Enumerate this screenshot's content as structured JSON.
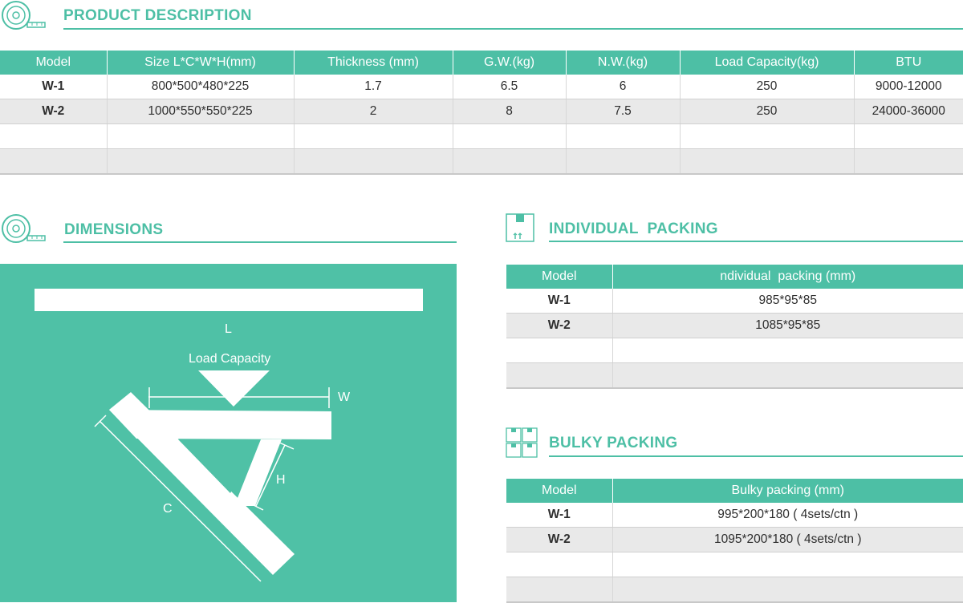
{
  "product_description": {
    "title": "PRODUCT DESCRIPTION",
    "icon": "tape-measure-icon",
    "columns": [
      "Model",
      "Size L*C*W*H(mm)",
      "Thickness (mm)",
      "G.W.(kg)",
      "N.W.(kg)",
      "Load Capacity(kg)",
      "BTU"
    ],
    "rows": [
      [
        "W-1",
        "800*500*480*225",
        "1.7",
        "6.5",
        "6",
        "250",
        "9000-12000"
      ],
      [
        "W-2",
        "1000*550*550*225",
        "2",
        "8",
        "7.5",
        "250",
        "24000-36000"
      ],
      [
        "",
        "",
        "",
        "",
        "",
        "",
        ""
      ],
      [
        "",
        "",
        "",
        "",
        "",
        "",
        ""
      ]
    ]
  },
  "dimensions": {
    "title": "DIMENSIONS",
    "icon": "tape-measure-icon",
    "labels": {
      "l": "L",
      "load_capacity": "Load Capacity",
      "w": "W",
      "h": "H",
      "c": "C"
    }
  },
  "individual_packing": {
    "title": "INDIVIDUAL  PACKING",
    "icon": "box-icon",
    "columns": [
      "Model",
      "ndividual  packing (mm)"
    ],
    "rows": [
      [
        "W-1",
        "985*95*85"
      ],
      [
        "W-2",
        "1085*95*85"
      ],
      [
        "",
        ""
      ],
      [
        "",
        ""
      ]
    ]
  },
  "bulky_packing": {
    "title": "BULKY PACKING",
    "icon": "boxes-icon",
    "columns": [
      "Model",
      "Bulky packing (mm)"
    ],
    "rows": [
      [
        "W-1",
        "995*200*180 ( 4sets/ctn )"
      ],
      [
        "W-2",
        "1095*200*180 ( 4sets/ctn )"
      ],
      [
        "",
        ""
      ],
      [
        "",
        ""
      ]
    ]
  },
  "colors": {
    "accent": "#4dbfa5",
    "panel": "#4fc1a6",
    "alt_row": "#e9e9e9"
  }
}
